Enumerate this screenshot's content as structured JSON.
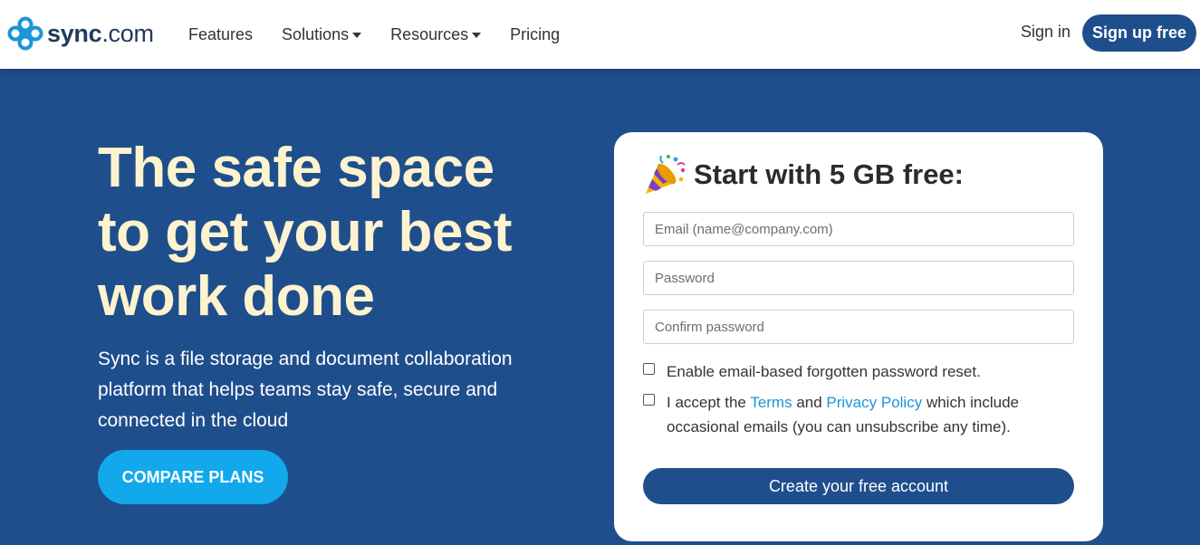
{
  "nav": {
    "logo_bold": "sync",
    "logo_rest": ".com",
    "links": [
      "Features",
      "Solutions",
      "Resources",
      "Pricing"
    ],
    "signin": "Sign in",
    "signup": "Sign up free"
  },
  "hero": {
    "title_lines": [
      "The safe space",
      "to get your best",
      "work done"
    ],
    "subtitle_lines": [
      "Sync is a file storage and document collaboration",
      "platform that helps teams stay safe, secure and",
      "connected in the cloud"
    ],
    "cta": "COMPARE PLANS"
  },
  "signup_form": {
    "title": "Start with 5 GB free:",
    "email_placeholder": "Email (name@company.com)",
    "password_placeholder": "Password",
    "confirm_placeholder": "Confirm password",
    "reset_option": "Enable email-based forgotten password reset.",
    "accept_prefix": "I accept the ",
    "terms_link": "Terms",
    "accept_and": " and ",
    "privacy_link": "Privacy Policy",
    "accept_suffix_line1": " which include",
    "accept_suffix_line2": "occasional emails (you can unsubscribe any time).",
    "submit": "Create your free account"
  },
  "colors": {
    "brand_navy": "#1f4e8c",
    "accent_cyan": "#11a9ec",
    "headline_cream": "#fdf3cf",
    "link_blue": "#1a95d8"
  },
  "icons": [
    "sync-logo-icon",
    "party-popper-icon",
    "chevron-down-icon"
  ]
}
